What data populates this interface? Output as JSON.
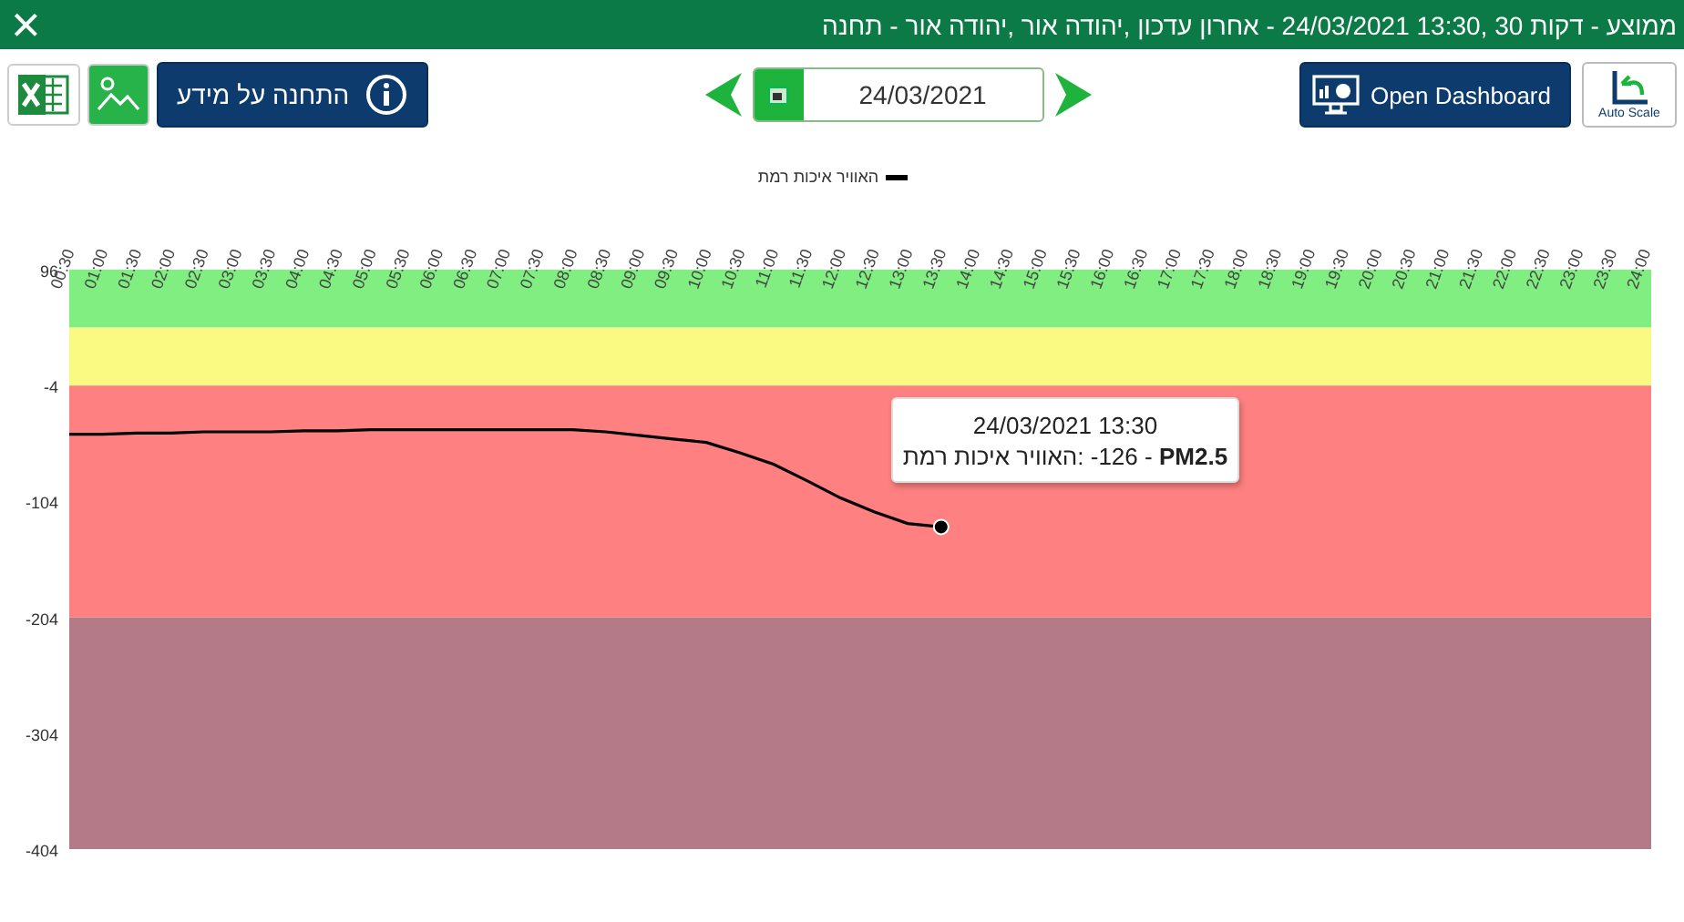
{
  "header": {
    "title": "תחנה - אור יהודה, אור יהודה, עדכון אחרון - 24/03/2021 13:30, 30 דקות - ממוצע",
    "close": "×"
  },
  "toolbar": {
    "info_button": "מידע על התחנה",
    "date": "24/03/2021",
    "dashboard_button": "Open Dashboard",
    "autoscale_button": "Auto Scale"
  },
  "chart": {
    "chart_data": {
      "type": "line",
      "categories": [
        "00:30",
        "01:00",
        "01:30",
        "02:00",
        "02:30",
        "03:00",
        "03:30",
        "04:00",
        "04:30",
        "05:00",
        "05:30",
        "06:00",
        "06:30",
        "07:00",
        "07:30",
        "08:00",
        "08:30",
        "09:00",
        "09:30",
        "10:00",
        "10:30",
        "11:00",
        "11:30",
        "12:00",
        "12:30",
        "13:00",
        "13:30",
        "14:00",
        "14:30",
        "15:00",
        "15:30",
        "16:00",
        "16:30",
        "17:00",
        "17:30",
        "18:00",
        "18:30",
        "19:00",
        "19:30",
        "20:00",
        "20:30",
        "21:00",
        "21:30",
        "22:00",
        "22:30",
        "23:00",
        "23:30",
        "24:00"
      ],
      "series": [
        {
          "name": "רמת איכות האוויר",
          "color": "#000000",
          "values": [
            -46,
            -46,
            -45,
            -45,
            -44,
            -44,
            -44,
            -43,
            -43,
            -42,
            -42,
            -42,
            -42,
            -42,
            -42,
            -42,
            -44,
            -47,
            -50,
            -53,
            -62,
            -72,
            -86,
            -101,
            -113,
            -123,
            -126,
            null,
            null,
            null,
            null,
            null,
            null,
            null,
            null,
            null,
            null,
            null,
            null,
            null,
            null,
            null,
            null,
            null,
            null,
            null,
            null,
            null
          ]
        }
      ],
      "ylim": [
        -404,
        96
      ],
      "yticks": [
        96,
        -4,
        -104,
        -204,
        -304,
        -404
      ],
      "bands": [
        {
          "axis": "y",
          "from": 46,
          "to": 96,
          "color": "#80ee80"
        },
        {
          "axis": "y",
          "from": -4,
          "to": 46,
          "color": "#fafa82"
        },
        {
          "axis": "y",
          "from": -204,
          "to": -4,
          "color": "#ff8080"
        },
        {
          "axis": "y",
          "from": -404,
          "to": -204,
          "color": "#b57a87"
        }
      ]
    },
    "tooltip": {
      "title": "24/03/2021 13:30",
      "text": "רמת איכות האוויר: -126 - **PM2.5**"
    }
  }
}
